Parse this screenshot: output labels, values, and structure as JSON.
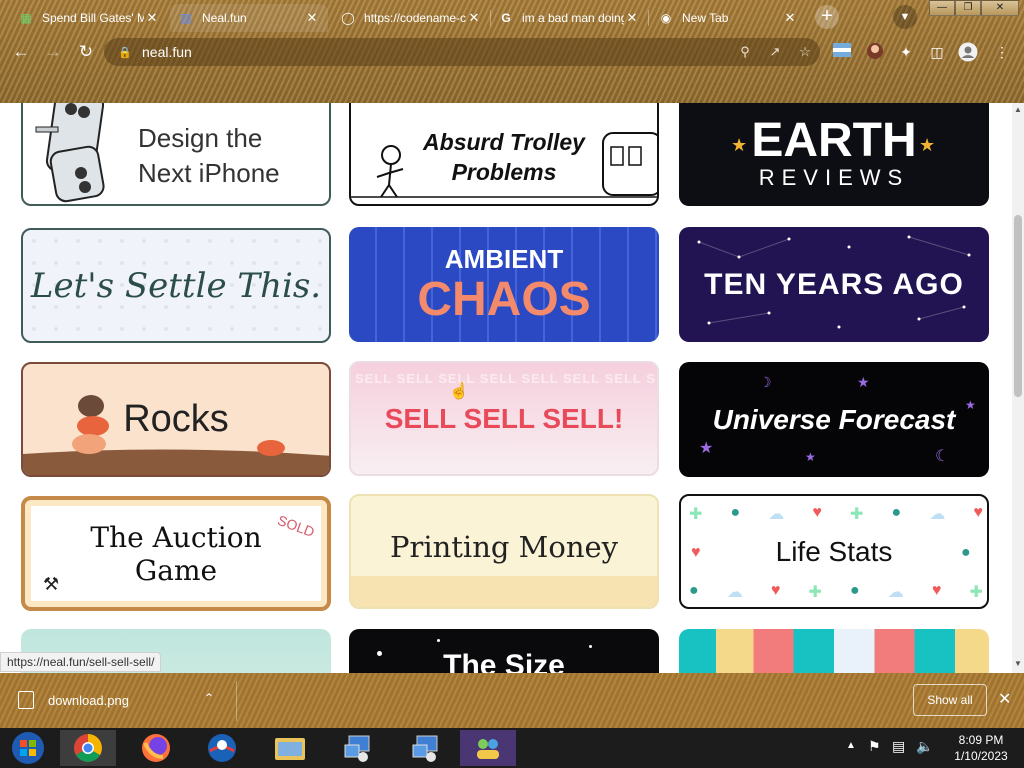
{
  "tabs": [
    {
      "title": "Spend Bill Gates' M",
      "icon": "money-icon"
    },
    {
      "title": "Neal.fun",
      "icon": "computer-icon"
    },
    {
      "title": "https://codename-c",
      "icon": "globe-icon"
    },
    {
      "title": "im a bad man doing",
      "icon": "google-icon"
    },
    {
      "title": "New Tab",
      "icon": "chrome-icon"
    }
  ],
  "address": {
    "url": "neal.fun"
  },
  "cards": {
    "iphone": {
      "line1": "Design the",
      "line2": "Next iPhone"
    },
    "trolley": {
      "line1": "Absurd Trolley",
      "line2": "Problems"
    },
    "earth": {
      "line1": "EARTH",
      "line2": "REVIEWS"
    },
    "settle": {
      "text": "Let's Settle This."
    },
    "ambient": {
      "line1": "AMBIENT",
      "line2": "CHAOS"
    },
    "tenyears": {
      "text": "TEN YEARS AGO"
    },
    "rocks": {
      "text": "Rocks"
    },
    "sell": {
      "text": "SELL SELL SELL!",
      "bg": "SELL SELL SELL SELL SELL SELL SELL SELL"
    },
    "universe": {
      "text": "Universe Forecast"
    },
    "auction": {
      "line1": "The Auction",
      "line2": "Game",
      "stamp": "SOLD"
    },
    "printing": {
      "text": "Printing Money"
    },
    "lifestats": {
      "text": "Life Stats"
    },
    "size": {
      "text": "The Size"
    }
  },
  "status_url": "https://neal.fun/sell-sell-sell/",
  "download": {
    "filename": "download.png",
    "show_all": "Show all"
  },
  "clock": {
    "time": "8:09 PM",
    "date": "1/10/2023"
  }
}
